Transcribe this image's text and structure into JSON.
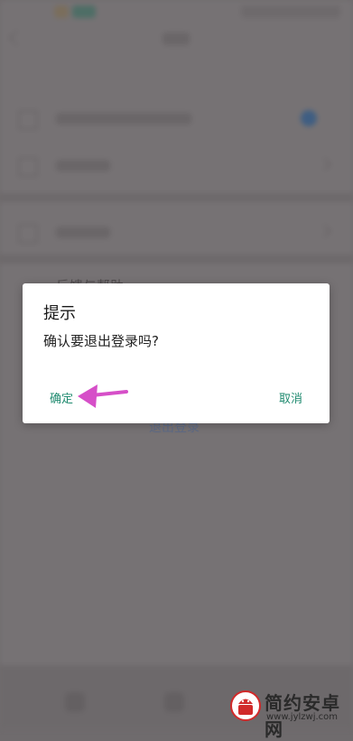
{
  "dialog": {
    "title": "提示",
    "message": "确认要退出登录吗?",
    "confirm_label": "确定",
    "cancel_label": "取消"
  },
  "background": {
    "partial_menu_text": "反馈与帮助",
    "logout_text": "退出登录"
  },
  "watermark": {
    "name": "简约安卓网",
    "url": "www.jylzwj.com"
  },
  "colors": {
    "accent": "#1f8a6f",
    "annotation_arrow": "#d64fc8",
    "scrim": "#6f6b6d"
  },
  "icons": [
    "back-icon",
    "chevron-right-icon",
    "annotation-arrow-icon",
    "android-logo-icon"
  ]
}
